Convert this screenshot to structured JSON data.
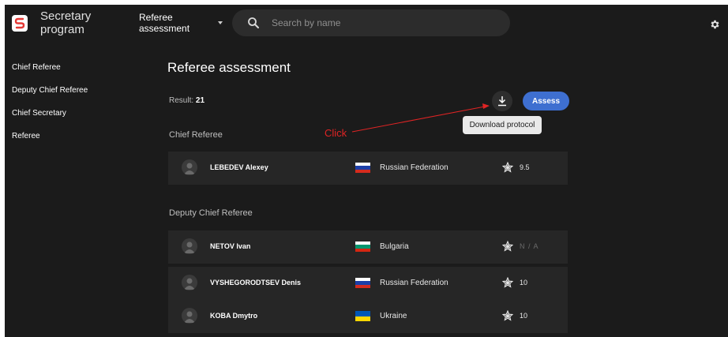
{
  "app": {
    "name_line1": "Secretary",
    "name_line2": "program"
  },
  "header": {
    "section_line1": "Referee",
    "section_line2": "assessment",
    "search_placeholder": "Search by name"
  },
  "sidebar": {
    "items": [
      {
        "label": "Chief Referee"
      },
      {
        "label": "Deputy Chief Referee"
      },
      {
        "label": "Chief Secretary"
      },
      {
        "label": "Referee"
      }
    ]
  },
  "main": {
    "title": "Referee assessment",
    "result_label": "Result:",
    "result_count": "21",
    "assess_label": "Assess",
    "download_tooltip": "Download protocol",
    "annotation": "Click",
    "groups": [
      {
        "title": "Chief Referee",
        "rows": [
          {
            "name": "LEBEDEV Alexey",
            "country": "Russian Federation",
            "score": "9.5",
            "flag": [
              "#ffffff",
              "#1c3fa8",
              "#d52b1e"
            ]
          }
        ]
      },
      {
        "title": "Deputy Chief Referee",
        "rows": [
          {
            "name": "NETOV Ivan",
            "country": "Bulgaria",
            "score": "N / A",
            "flag": [
              "#ffffff",
              "#00966e",
              "#d62612"
            ]
          },
          {
            "name": "VYSHEGORODTSEV Denis",
            "country": "Russian Federation",
            "score": "10",
            "flag": [
              "#ffffff",
              "#1c3fa8",
              "#d52b1e"
            ]
          },
          {
            "name": "KOBA Dmytro",
            "country": "Ukraine",
            "score": "10",
            "flag": [
              "#0057b7",
              "#ffd700"
            ]
          }
        ]
      }
    ]
  },
  "colors": {
    "background": "#1b1b1b",
    "row_background": "#262626",
    "accent": "#3e6fd0",
    "annotation": "#e02424"
  },
  "icons": {
    "logo": "app-logo-icon",
    "search": "search-icon",
    "settings": "gear-icon",
    "download": "download-icon",
    "avatar": "avatar-placeholder-icon",
    "rating": "star-icon"
  }
}
